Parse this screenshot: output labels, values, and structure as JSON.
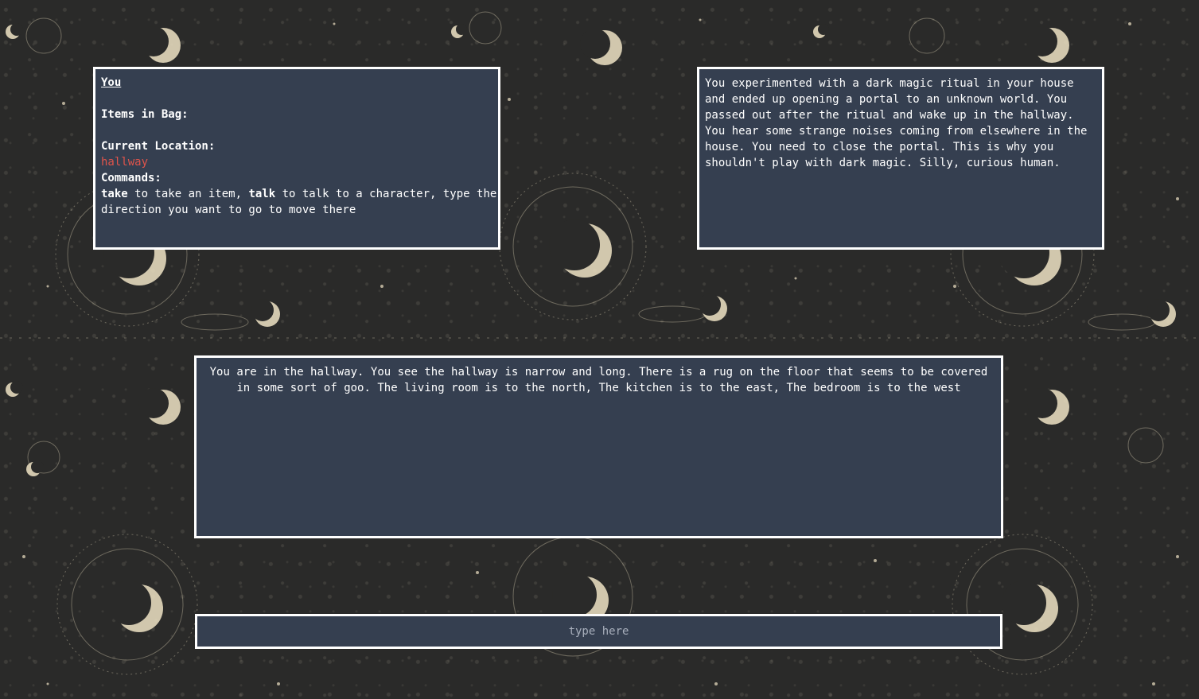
{
  "colors": {
    "panel_bg": "#353f50",
    "panel_border": "#ffffff",
    "text": "#ffffff",
    "location_highlight": "#e0544b",
    "background": "#2a2a29",
    "background_art": "#efe3c4"
  },
  "status": {
    "player_label": "You",
    "items_heading": "Items in Bag:",
    "location_heading": "Current Location:",
    "location_value": "hallway",
    "commands_heading": "Commands:",
    "cmd_take": "take",
    "take_desc": " to take an item, ",
    "cmd_talk": "talk",
    "talk_desc": " to talk to a character, type the direction you want to go to move there"
  },
  "intro": {
    "text": "You experimented with a dark magic ritual in your house and ended up opening a portal to an unknown world. You passed out after the ritual and wake up in the hallway. You hear some strange noises coming from elsewhere in the house. You need to close the portal. This is why you shouldn't play with dark magic. Silly, curious human."
  },
  "room": {
    "description": "You are in the hallway. You see the hallway is narrow and long. There is a rug on the floor that seems to be covered in some sort of goo. The living room is to the north, The kitchen is to the east, The bedroom is to the west"
  },
  "command_input": {
    "placeholder": "type here",
    "value": ""
  }
}
